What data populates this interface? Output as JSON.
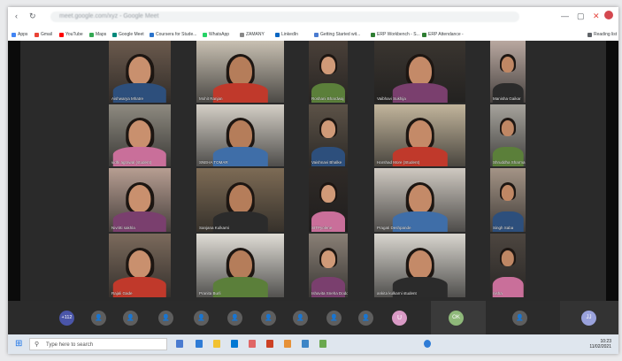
{
  "browser": {
    "url_text": "meet.google.com/xyz - Google Meet",
    "controls": [
      "—",
      "▢",
      "✕"
    ]
  },
  "bookmarks": [
    {
      "label": "Apps",
      "color": "#4285f4"
    },
    {
      "label": "Gmail",
      "color": "#ea4335"
    },
    {
      "label": "YouTube",
      "color": "#ff0000"
    },
    {
      "label": "Maps",
      "color": "#34a853"
    },
    {
      "label": "Google Meet",
      "color": "#00897b"
    },
    {
      "label": "Coursera for Stude...",
      "color": "#2a73cc"
    },
    {
      "label": "WhatsApp",
      "color": "#25d366"
    },
    {
      "label": "ZAMANY",
      "color": "#888888"
    },
    {
      "label": "LinkedIn",
      "color": "#0a66c2"
    },
    {
      "label": "Getting Started wit...",
      "color": "#4a7bd0"
    },
    {
      "label": "ERP Workbench - S...",
      "color": "#2e7d32"
    },
    {
      "label": "ERP Attendance -",
      "color": "#2e7d32"
    },
    {
      "label": "Reading list",
      "color": "#5f6368"
    }
  ],
  "participants": [
    {
      "name": "Aishwarya Mhatre"
    },
    {
      "name": "Mohit Ranjan"
    },
    {
      "name": "Roshani Bhardwaj"
    },
    {
      "name": "Vaibhavi Sukhija"
    },
    {
      "name": "Manisha Gaikar"
    },
    {
      "name": "vidhi agrawal (student)"
    },
    {
      "name": "SNEHA TOMAR"
    },
    {
      "name": "Vaishnavi Bhalke"
    },
    {
      "name": "Harshad More (Student)"
    },
    {
      "name": "Shruddha Sharma"
    },
    {
      "name": "Nivritti sakhla"
    },
    {
      "name": "Sanjana Kulkarni"
    },
    {
      "name": "SITPyolene"
    },
    {
      "name": "Pragati Deshpande"
    },
    {
      "name": "Singh Saba"
    },
    {
      "name": "Rajali Gade"
    },
    {
      "name": "Pranita Burli"
    },
    {
      "name": "Ishavita Sneha Dodda"
    },
    {
      "name": "ankita kulkarni student"
    },
    {
      "name": "nisha"
    }
  ],
  "toolbar": {
    "more_label": "+112",
    "pink_initial": "U",
    "ok_label": "OK",
    "self_initial": "JJ"
  },
  "taskbar": {
    "search_placeholder": "Type here to search",
    "time": "10:23",
    "date": "11/02/2021"
  }
}
